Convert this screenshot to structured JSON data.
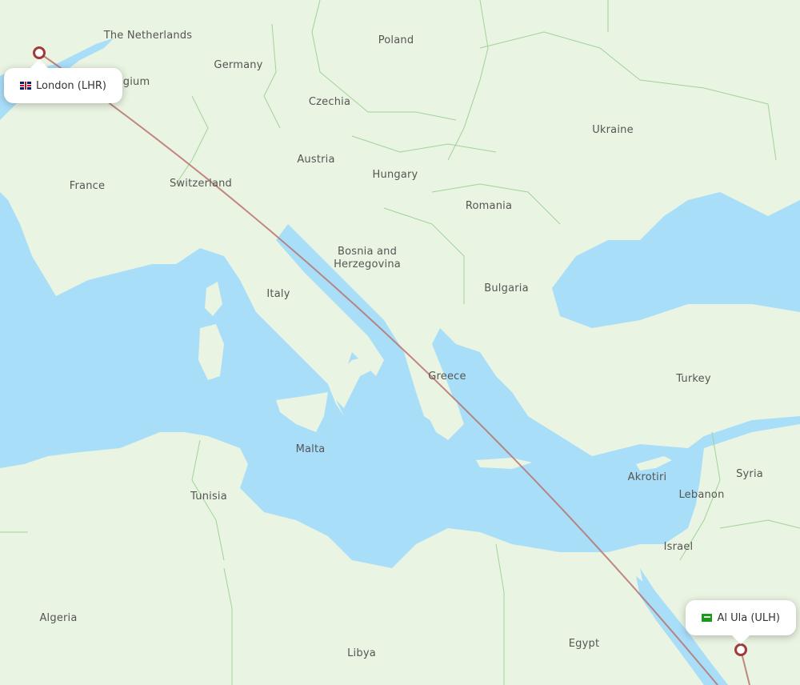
{
  "map": {
    "colors": {
      "water": "#a9def9",
      "land": "#eaf4e2",
      "border": "#9fd39a",
      "route": "#b8736f",
      "pin": "#a33a3a"
    },
    "country_labels": [
      {
        "name": "The Netherlands"
      },
      {
        "name": "Poland"
      },
      {
        "name": "Germany"
      },
      {
        "name": "Belgium"
      },
      {
        "name": "Czechia"
      },
      {
        "name": "Ukraine"
      },
      {
        "name": "Austria"
      },
      {
        "name": "Hungary"
      },
      {
        "name": "France"
      },
      {
        "name": "Switzerland"
      },
      {
        "name": "Romania"
      },
      {
        "name": "Bosnia and Herzegovina"
      },
      {
        "name": "Bulgaria"
      },
      {
        "name": "Italy"
      },
      {
        "name": "Greece"
      },
      {
        "name": "Turkey"
      },
      {
        "name": "Malta"
      },
      {
        "name": "Akrotiri"
      },
      {
        "name": "Syria"
      },
      {
        "name": "Tunisia"
      },
      {
        "name": "Lebanon"
      },
      {
        "name": "Israel"
      },
      {
        "name": "Algeria"
      },
      {
        "name": "Egypt"
      },
      {
        "name": "Libya"
      }
    ],
    "origin": {
      "label": "London (LHR)",
      "flag": "uk-flag"
    },
    "destination": {
      "label": "Al Ula (ULH)",
      "flag": "saudi-arabia-flag"
    }
  }
}
